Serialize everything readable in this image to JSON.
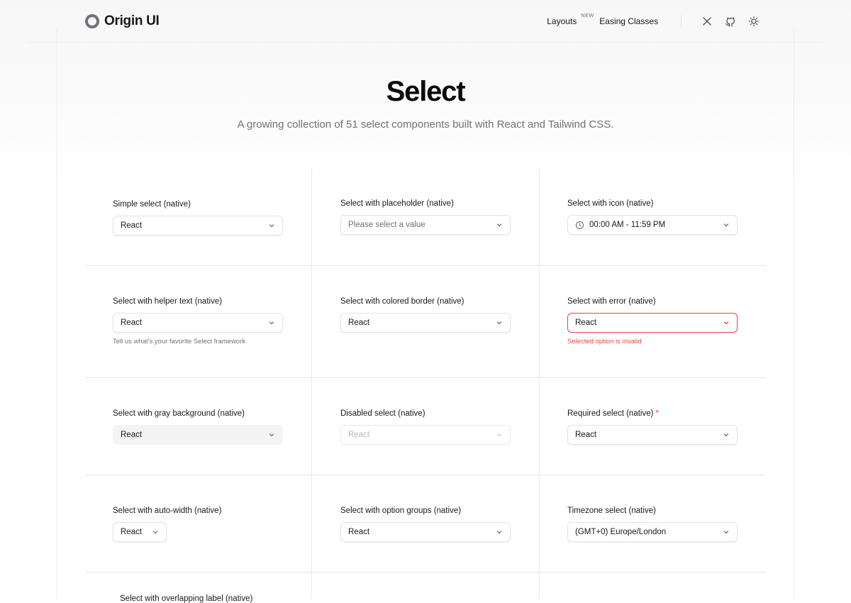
{
  "app": {
    "logo_text": "Origin UI",
    "nav": {
      "layouts_label": "Layouts",
      "layouts_badge": "NEW",
      "easing_label": "Easing Classes"
    },
    "icons": [
      "x-twitter-icon",
      "github-icon",
      "sun-icon"
    ]
  },
  "hero": {
    "title": "Select",
    "subtitle": "A growing collection of 51 select components built with React and Tailwind CSS."
  },
  "colors": {
    "text": "#18181b",
    "muted": "#71717a",
    "border": "#e4e4e7",
    "error": "#ef4444",
    "gray_bg": "#f4f4f5"
  },
  "demos": [
    {
      "label": "Simple select (native)",
      "value": "React"
    },
    {
      "label": "Select with placeholder (native)",
      "placeholder": "Please select a value"
    },
    {
      "label": "Select with icon (native)",
      "value": "00:00 AM - 11:59 PM",
      "icon": "clock-icon"
    },
    {
      "label": "Select with helper text (native)",
      "value": "React",
      "helper": "Tell us what's your favorite Select framework"
    },
    {
      "label": "Select with colored border (native)",
      "value": "React"
    },
    {
      "label": "Select with error (native)",
      "value": "React",
      "error": "Selected option is invalid"
    },
    {
      "label": "Select with gray background (native)",
      "value": "React"
    },
    {
      "label": "Disabled select (native)",
      "value": "React"
    },
    {
      "label": "Required select (native)",
      "required_mark": "*",
      "value": "React"
    },
    {
      "label": "Select with auto-width (native)",
      "value": "React"
    },
    {
      "label": "Select with option groups (native)",
      "value": "React"
    },
    {
      "label": "Timezone select (native)",
      "value": "(GMT+0) Europe/London"
    }
  ],
  "partial_label": "Select with overlapping label (native)"
}
